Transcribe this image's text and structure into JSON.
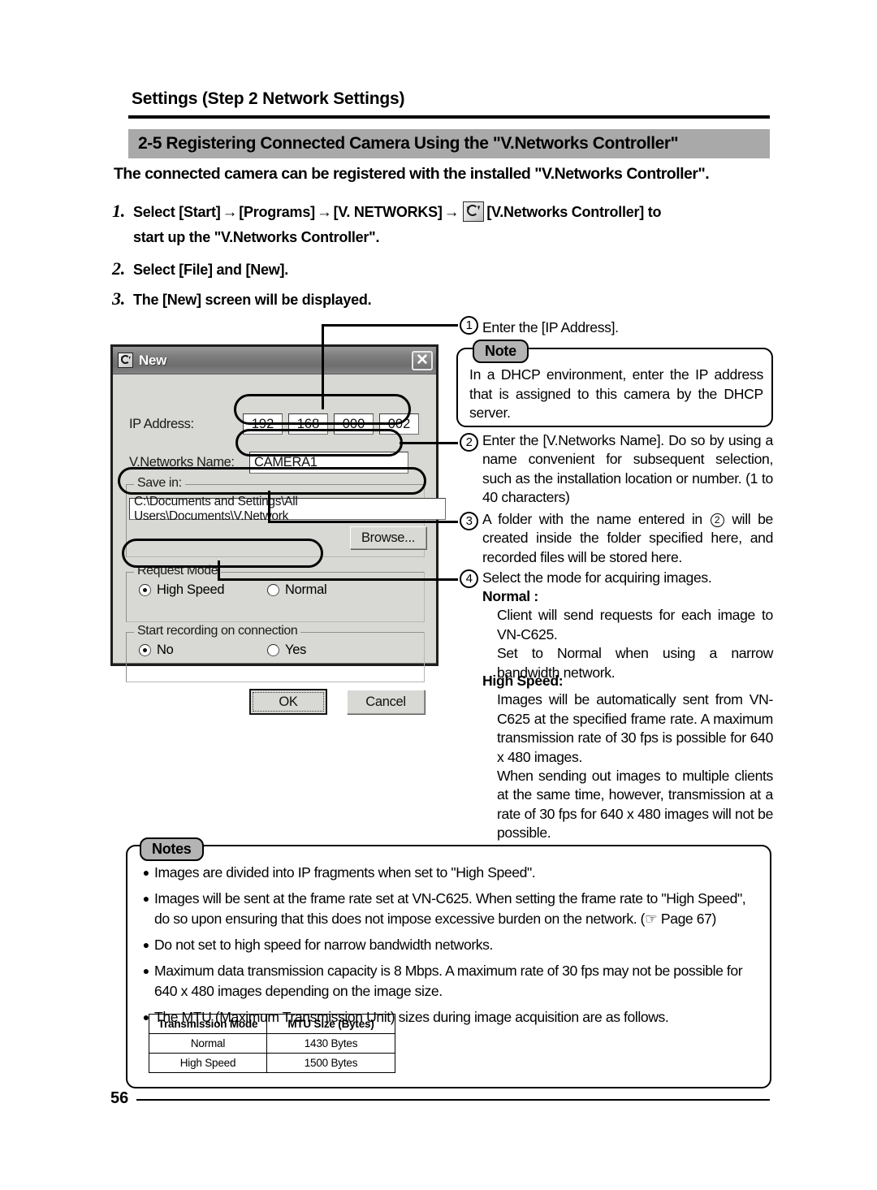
{
  "header": {
    "section_title": "Settings (Step 2 Network Settings)",
    "band_title": "2-5 Registering Connected Camera Using the \"V.Networks Controller\"",
    "lead": "The connected camera can be registered with the installed \"V.Networks Controller\"."
  },
  "steps": {
    "step1": {
      "num": "1.",
      "part1": "Select [Start]",
      "arrow1": "→",
      "part2": "[Programs]",
      "arrow2": "→",
      "part3": "[V. NETWORKS]",
      "arrow3": "→",
      "icon": "v-networks-icon",
      "part4": "[V.Networks Controller] to",
      "line2": "start up the \"V.Networks Controller\"."
    },
    "step2": {
      "num": "2.",
      "text": "Select [File] and [New]."
    },
    "step3": {
      "num": "3.",
      "text": "The [New] screen will be displayed."
    }
  },
  "dialog": {
    "title": "New",
    "close_label": "✕",
    "ip_label": "IP Address:",
    "ip_octets": [
      "192",
      "168",
      "000",
      "002"
    ],
    "name_label": "V.Networks Name:",
    "name_value": "CAMERA1",
    "savein_label": "Save in:",
    "savein_value": "C:\\Documents and Settings\\All Users\\Documents\\V.Network",
    "browse_label": "Browse...",
    "request_mode_label": "Request Mode",
    "request_mode_options": [
      "High Speed",
      "Normal"
    ],
    "request_mode_selected": "High Speed",
    "start_rec_label": "Start recording on connection",
    "start_rec_options": [
      "No",
      "Yes"
    ],
    "start_rec_selected": "No",
    "ok_label": "OK",
    "cancel_label": "Cancel"
  },
  "callouts": {
    "c1": {
      "num": "1",
      "text": "Enter the [IP Address]."
    },
    "c2": {
      "num": "2",
      "text": "Enter the [V.Networks Name]. Do so by using a name convenient for subsequent selection, such as the installation location or number. (1 to 40 characters)"
    },
    "c3_pre": "A folder with the name entered in",
    "c3_ref": "2",
    "c3_post": "will be created inside the folder specified here, and recorded files will be stored here.",
    "c3_num": "3",
    "c4": {
      "num": "4",
      "text": "Select the mode for acquiring images."
    }
  },
  "note": {
    "tag": "Note",
    "body": "In a DHCP environment, enter the IP address that is assigned to this camera by the DHCP server."
  },
  "modes": {
    "normal_heading": "Normal :",
    "normal_p1": "Client will send requests for each image to VN-C625.",
    "normal_p2": "Set to Normal when using a narrow bandwidth network.",
    "high_heading": "High Speed:",
    "high_p1": "Images will be automatically sent from VN-C625 at the specified frame rate. A maximum transmission rate of 30 fps is possible for 640 x 480 images.",
    "high_p2": "When sending out images to multiple clients at the same time, however, transmission at a rate of  30 fps for 640 x 480 images will not be possible."
  },
  "notes": {
    "tag": "Notes",
    "bullet": "●",
    "items": [
      "Images are divided into IP fragments when set to \"High Speed\".",
      "Images will be sent at the frame rate set at VN-C625. When setting the frame rate to \"High Speed\", do so upon ensuring that this does not impose excessive burden on the network. (☞ Page 67)",
      "Do not set to high speed for narrow bandwidth networks.",
      "Maximum data transmission capacity is 8 Mbps. A maximum rate of 30 fps may not be possible for 640 x 480 images depending on the image size.",
      "The MTU (Maximum Transmission Unit) sizes during image acquisition are as follows."
    ]
  },
  "mtu_table": {
    "headers": [
      "Transmission Mode",
      "MTU Size (Bytes)"
    ],
    "rows": [
      [
        "Normal",
        "1430 Bytes"
      ],
      [
        "High Speed",
        "1500 Bytes"
      ]
    ]
  },
  "footer": {
    "page_number": "56"
  }
}
